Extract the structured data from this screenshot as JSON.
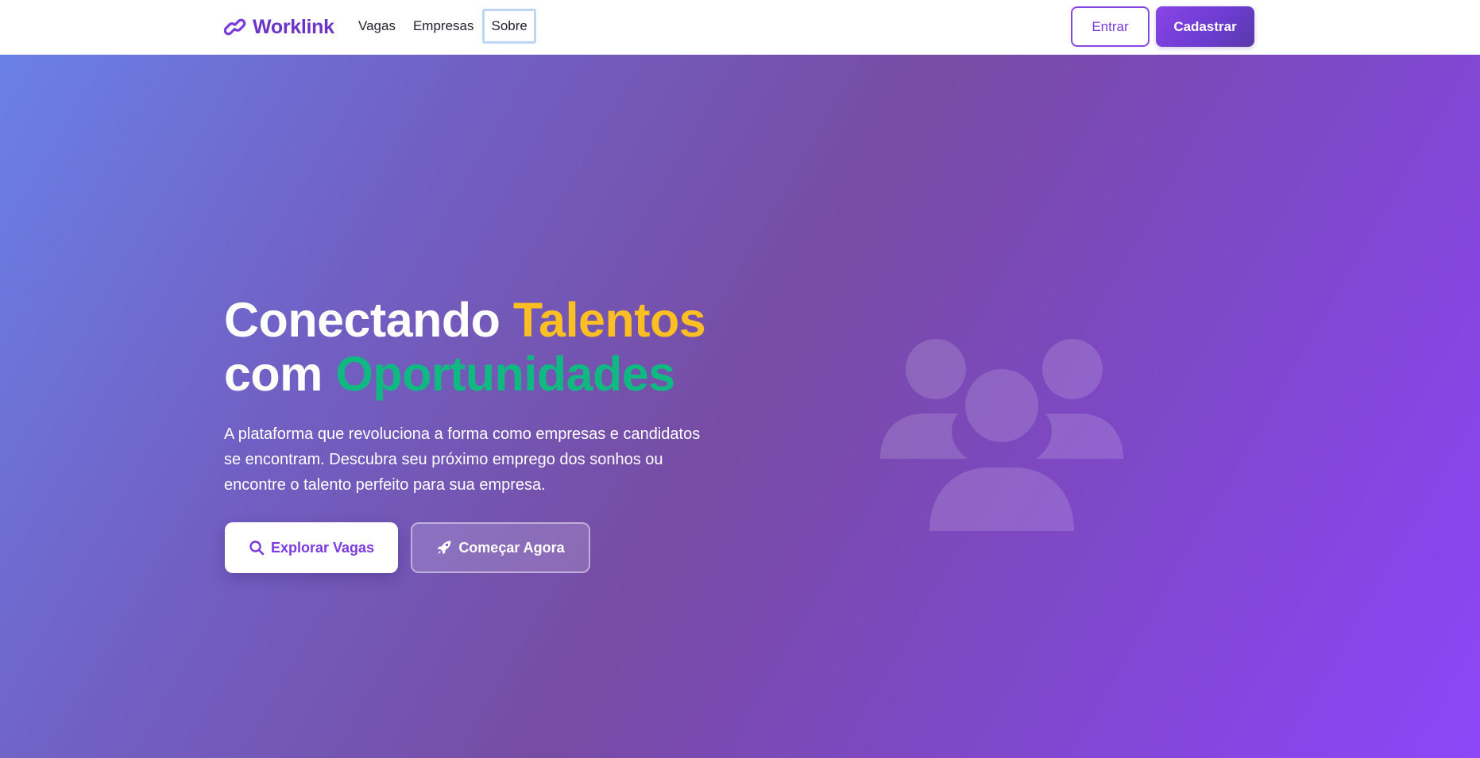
{
  "brand": {
    "name": "Worklink",
    "icon": "link-icon",
    "color": "#6b35c8"
  },
  "nav": {
    "items": [
      {
        "label": "Vagas"
      },
      {
        "label": "Empresas"
      },
      {
        "label": "Sobre"
      }
    ],
    "focused_item": "Sobre"
  },
  "auth": {
    "login_label": "Entrar",
    "signup_label": "Cadastrar"
  },
  "hero": {
    "headline": {
      "part1": "Conectando ",
      "highlight1": "Talentos",
      "part2": "com ",
      "highlight2": "Oportunidades"
    },
    "subtitle": "A plataforma que revoluciona a forma como empresas e candidatos se encontram. Descubra seu próximo emprego dos sonhos ou encontre o talento perfeito para sua empresa.",
    "primary_cta": {
      "label": "Explorar Vagas",
      "icon": "search-icon"
    },
    "secondary_cta": {
      "label": "Começar Agora",
      "icon": "rocket-icon"
    },
    "illustration_icon": "users-icon"
  },
  "colors": {
    "accent": "#7b3be0",
    "highlight_yellow": "#fbbf24",
    "highlight_green": "#10b981",
    "gradient_start": "#6a80e6",
    "gradient_end": "#8c47f7"
  }
}
